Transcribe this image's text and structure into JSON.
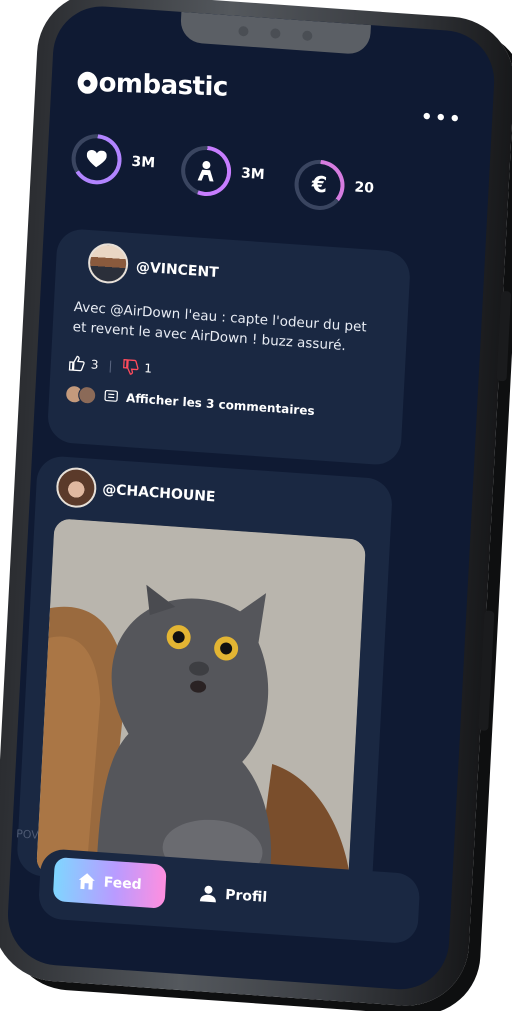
{
  "app": {
    "logo_text": "ombastic"
  },
  "stats": [
    {
      "icon": "heart-icon",
      "value": "3M",
      "color": "#b184ff"
    },
    {
      "icon": "person-icon",
      "value": "3M",
      "color": "#c77dff"
    },
    {
      "icon": "euro-icon",
      "value": "20",
      "color": "#d67ce0"
    }
  ],
  "posts": [
    {
      "username": "@VINCENT",
      "text": "Avec @AirDown l'eau : capte l'odeur du pet et revent le avec AirDown ! buzz assuré.",
      "likes": "3",
      "dislikes": "1",
      "comments_label": "Afficher les 3 commentaires"
    },
    {
      "username": "@CHACHOUNE"
    }
  ],
  "nav": {
    "pov": "POV",
    "feed": "Feed",
    "profil": "Profil"
  },
  "colors": {
    "accent_start": "#7fd6ff",
    "accent_mid": "#b99bff",
    "accent_end": "#ff8fe0",
    "screen_bg": "#0f1a33",
    "card_bg": "#1a2842"
  }
}
